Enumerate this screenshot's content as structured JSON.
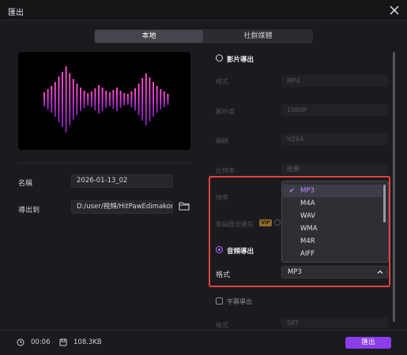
{
  "window": {
    "title": "匯出"
  },
  "tabs": {
    "local": "本地",
    "social": "社群媒體"
  },
  "file": {
    "name_label": "名稱",
    "name_value": "2026-01-13_02",
    "export_to_label": "導出到",
    "export_path": "D:/user/視頻/HitPawEdimakor"
  },
  "video_export": {
    "label": "影片導出",
    "selected": false,
    "format_label": "格式",
    "format_value": "MP4",
    "resolution_label": "解析度",
    "resolution_value": "1080P",
    "encoder_label": "編碼",
    "encoder_value": "H264",
    "bitrate_label": "比特率",
    "bitrate_value": "推薦",
    "framerate_label": "幀率",
    "lossless_label": "無損匯出優先",
    "vip_badge": "VIP"
  },
  "audio_export": {
    "label": "音頻導出",
    "selected": true,
    "format_label": "格式",
    "format_value": "MP3",
    "format_options": [
      "MP3",
      "M4A",
      "WAV",
      "WMA",
      "M4R",
      "AIFF"
    ],
    "selected_option": "MP3"
  },
  "subtitle_export": {
    "label": "字幕導出",
    "checked": false,
    "format_label": "格式",
    "format_value": "SRT"
  },
  "footer": {
    "duration": "00:06",
    "filesize": "108.3KB",
    "export_button": "匯出"
  },
  "colors": {
    "accent": "#8b3dea",
    "highlight": "#e8433f",
    "waveform": "#d23ad6"
  },
  "icons": [
    "close-icon",
    "folder-icon",
    "clock-icon",
    "file-size-icon",
    "chevron-up-icon",
    "check-icon",
    "info-icon"
  ]
}
